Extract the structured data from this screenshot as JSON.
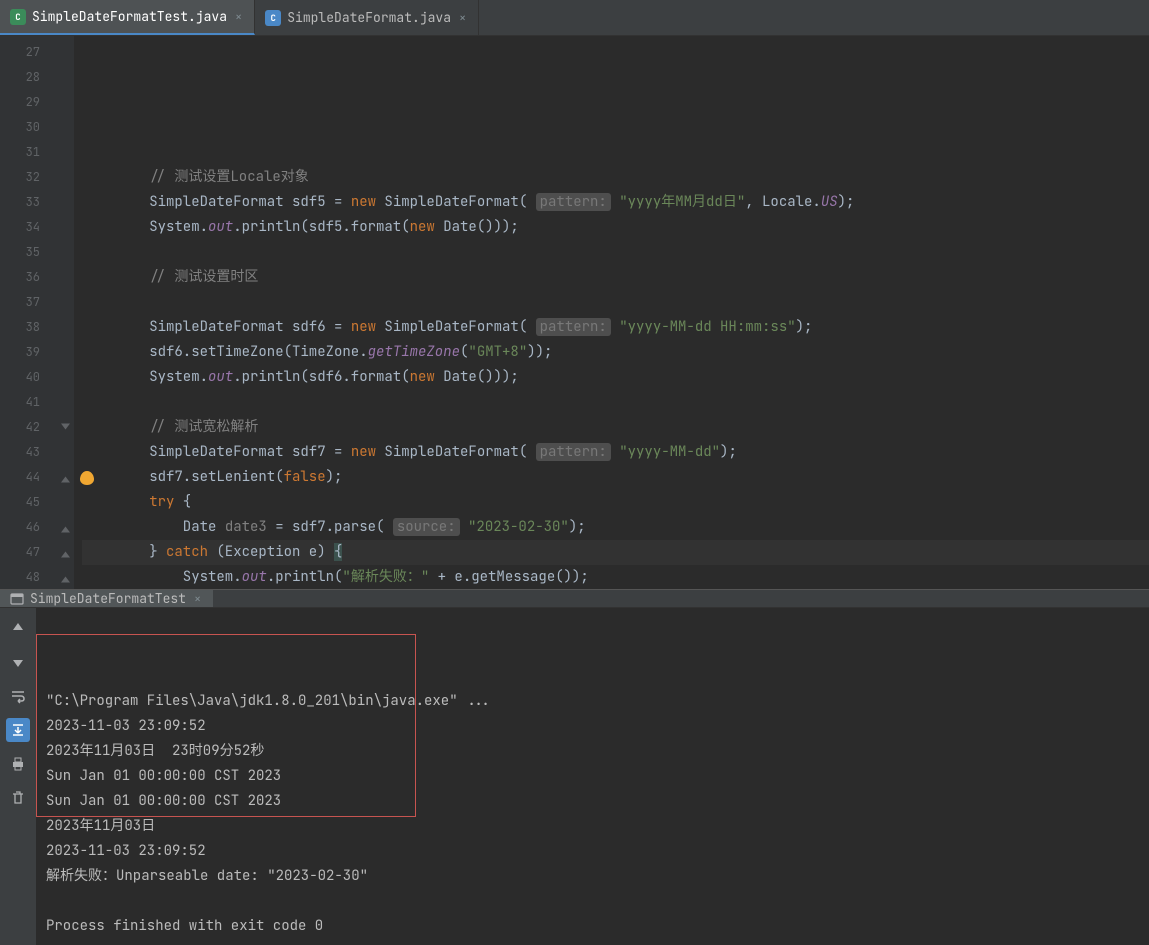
{
  "tabs": [
    {
      "label": "SimpleDateFormatTest.java",
      "active": true,
      "icon": "test"
    },
    {
      "label": "SimpleDateFormat.java",
      "active": false,
      "icon": "class"
    }
  ],
  "gutter": {
    "start": 27,
    "end": 49,
    "markers": {
      "42": "open",
      "44": "close",
      "46": "close",
      "47": "close",
      "48": "close"
    },
    "bulb_line": 44,
    "current_line": 44,
    "modify_stripe": {
      "from": 43,
      "to": 46
    }
  },
  "code": {
    "27": [],
    "28": [],
    "29": [
      {
        "t": "        "
      },
      {
        "t": "// 测试设置Locale对象",
        "c": "cm"
      }
    ],
    "30": [
      {
        "t": "        SimpleDateFormat sdf5 = "
      },
      {
        "t": "new",
        "c": "kw"
      },
      {
        "t": " SimpleDateFormat( "
      },
      {
        "t": "pattern:",
        "c": "hint"
      },
      {
        "t": " "
      },
      {
        "t": "\"yyyy年MM月dd日\"",
        "c": "str"
      },
      {
        "t": ", Locale."
      },
      {
        "t": "US",
        "c": "fld"
      },
      {
        "t": ");"
      }
    ],
    "31": [
      {
        "t": "        System."
      },
      {
        "t": "out",
        "c": "fld"
      },
      {
        "t": ".println(sdf5.format("
      },
      {
        "t": "new",
        "c": "kw"
      },
      {
        "t": " Date()));"
      }
    ],
    "32": [],
    "33": [
      {
        "t": "        "
      },
      {
        "t": "// 测试设置时区",
        "c": "cm"
      }
    ],
    "34": [],
    "35": [
      {
        "t": "        SimpleDateFormat sdf6 = "
      },
      {
        "t": "new",
        "c": "kw"
      },
      {
        "t": " SimpleDateFormat( "
      },
      {
        "t": "pattern:",
        "c": "hint"
      },
      {
        "t": " "
      },
      {
        "t": "\"yyyy-MM-dd HH:mm:ss\"",
        "c": "str"
      },
      {
        "t": ");"
      }
    ],
    "36": [
      {
        "t": "        sdf6.setTimeZone(TimeZone."
      },
      {
        "t": "getTimeZone",
        "c": "fld"
      },
      {
        "t": "("
      },
      {
        "t": "\"GMT+8\"",
        "c": "str"
      },
      {
        "t": "));"
      }
    ],
    "37": [
      {
        "t": "        System."
      },
      {
        "t": "out",
        "c": "fld"
      },
      {
        "t": ".println(sdf6.format("
      },
      {
        "t": "new",
        "c": "kw"
      },
      {
        "t": " Date()));"
      }
    ],
    "38": [],
    "39": [
      {
        "t": "        "
      },
      {
        "t": "// 测试宽松解析",
        "c": "cm"
      }
    ],
    "40": [
      {
        "t": "        SimpleDateFormat sdf7 = "
      },
      {
        "t": "new",
        "c": "kw"
      },
      {
        "t": " SimpleDateFormat( "
      },
      {
        "t": "pattern:",
        "c": "hint"
      },
      {
        "t": " "
      },
      {
        "t": "\"yyyy-MM-dd\"",
        "c": "str"
      },
      {
        "t": ");"
      }
    ],
    "41": [
      {
        "t": "        sdf7.setLenient("
      },
      {
        "t": "false",
        "c": "kw"
      },
      {
        "t": ");"
      }
    ],
    "42": [
      {
        "t": "        "
      },
      {
        "t": "try",
        "c": "kw"
      },
      {
        "t": " {"
      }
    ],
    "43": [
      {
        "t": "            Date "
      },
      {
        "t": "date3",
        "c": "cm"
      },
      {
        "t": " = sdf7.parse( "
      },
      {
        "t": "source:",
        "c": "hint"
      },
      {
        "t": " "
      },
      {
        "t": "\"2023-02-30\"",
        "c": "str"
      },
      {
        "t": ");"
      }
    ],
    "44": [
      {
        "t": "        } "
      },
      {
        "t": "catch",
        "c": "kw"
      },
      {
        "t": " (Exception e) "
      },
      {
        "t": "{",
        "bg": "hl"
      }
    ],
    "45": [
      {
        "t": "            System."
      },
      {
        "t": "out",
        "c": "fld"
      },
      {
        "t": ".println("
      },
      {
        "t": "\"解析失败：\"",
        "c": "str"
      },
      {
        "t": " + e.getMessage());"
      }
    ],
    "46": [
      {
        "t": "        "
      },
      {
        "t": "}",
        "bg": "hl"
      }
    ],
    "47": [
      {
        "t": "    }"
      }
    ],
    "48": [
      {
        "t": "}"
      }
    ],
    "49": []
  },
  "run": {
    "tab_label": "SimpleDateFormatTest",
    "lines": [
      "\"C:\\Program Files\\Java\\jdk1.8.0_201\\bin\\java.exe\" ...",
      "2023-11-03 23:09:52",
      "2023年11月03日  23时09分52秒",
      "Sun Jan 01 00:00:00 CST 2023",
      "Sun Jan 01 00:00:00 CST 2023",
      "2023年11月03日",
      "2023-11-03 23:09:52",
      "解析失败：Unparseable date: \"2023-02-30\"",
      "",
      "Process finished with exit code 0"
    ],
    "highlight": {
      "from_line": 1,
      "to_line": 7
    },
    "toolbar": [
      {
        "name": "up-arrow-icon",
        "active": false
      },
      {
        "name": "down-arrow-icon",
        "active": false
      },
      {
        "name": "soft-wrap-icon",
        "active": false
      },
      {
        "name": "scroll-end-icon",
        "active": true
      },
      {
        "name": "print-icon",
        "active": false
      },
      {
        "name": "trash-icon",
        "active": false
      }
    ]
  }
}
